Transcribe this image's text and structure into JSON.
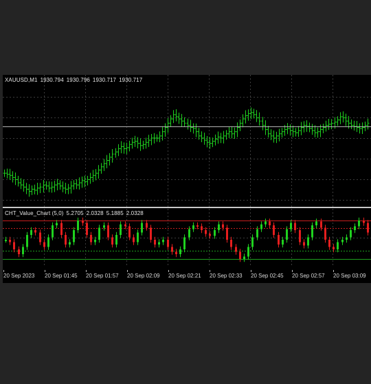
{
  "main": {
    "symbol": "XAUUSD,M1",
    "open": "1930.794",
    "high": "1930.796",
    "low": "1930.717",
    "close": "1930.717"
  },
  "indicator": {
    "name": "CHT_Value_Chart (5,0)",
    "v1": "5.2705",
    "v2": "2.0328",
    "v3": "5.1885",
    "v4": "2.0328"
  },
  "time_axis": [
    "20 Sep 2023",
    "20 Sep 01:45",
    "20 Sep 01:57",
    "20 Sep 02:09",
    "20 Sep 02:21",
    "20 Sep 02:33",
    "20 Sep 02:45",
    "20 Sep 02:57",
    "20 Sep 03:09"
  ],
  "colors": {
    "background": "#000000",
    "grid": "#3c3c3c",
    "bar_up": "#1fd21f",
    "bar_down": "#e61e1e",
    "level_red": "#c81e1e",
    "level_green": "#1ea01e",
    "price_line": "#b4b4b4"
  },
  "chart_data": [
    {
      "type": "ohlc",
      "series": "XAUUSD,M1",
      "closes": [
        0.27,
        0.26,
        0.25,
        0.23,
        0.21,
        0.18,
        0.16,
        0.14,
        0.12,
        0.1,
        0.12,
        0.11,
        0.13,
        0.14,
        0.16,
        0.15,
        0.13,
        0.14,
        0.16,
        0.17,
        0.15,
        0.13,
        0.12,
        0.13,
        0.15,
        0.17,
        0.16,
        0.18,
        0.2,
        0.19,
        0.21,
        0.23,
        0.25,
        0.27,
        0.3,
        0.33,
        0.36,
        0.39,
        0.42,
        0.45,
        0.47,
        0.5,
        0.52,
        0.5,
        0.51,
        0.54,
        0.56,
        0.57,
        0.55,
        0.53,
        0.54,
        0.56,
        0.58,
        0.6,
        0.6,
        0.6,
        0.62,
        0.66,
        0.7,
        0.74,
        0.78,
        0.82,
        0.8,
        0.78,
        0.76,
        0.74,
        0.72,
        0.7,
        0.69,
        0.66,
        0.62,
        0.6,
        0.58,
        0.56,
        0.55,
        0.57,
        0.59,
        0.61,
        0.6,
        0.62,
        0.64,
        0.66,
        0.64,
        0.66,
        0.7,
        0.74,
        0.78,
        0.81,
        0.83,
        0.84,
        0.82,
        0.79,
        0.76,
        0.72,
        0.68,
        0.64,
        0.62,
        0.6,
        0.62,
        0.64,
        0.66,
        0.68,
        0.69,
        0.67,
        0.66,
        0.65,
        0.67,
        0.7,
        0.72,
        0.71,
        0.69,
        0.67,
        0.65,
        0.66,
        0.68,
        0.7,
        0.72,
        0.73,
        0.74,
        0.75,
        0.77,
        0.8,
        0.79,
        0.76,
        0.74,
        0.72,
        0.71,
        0.7,
        0.69,
        0.7,
        0.72,
        0.74
      ],
      "current_price_level": 0.71
    },
    {
      "type": "ohlc",
      "series": "CHT_Value_Chart (5,0)",
      "closes": [
        0.5,
        0.45,
        0.3,
        0.2,
        0.35,
        0.6,
        0.7,
        0.65,
        0.45,
        0.35,
        0.55,
        0.8,
        0.85,
        0.6,
        0.4,
        0.45,
        0.7,
        0.9,
        0.85,
        0.6,
        0.45,
        0.5,
        0.75,
        0.8,
        0.55,
        0.4,
        0.6,
        0.82,
        0.78,
        0.55,
        0.45,
        0.65,
        0.85,
        0.75,
        0.5,
        0.4,
        0.45,
        0.5,
        0.35,
        0.25,
        0.2,
        0.3,
        0.55,
        0.72,
        0.8,
        0.78,
        0.7,
        0.62,
        0.58,
        0.7,
        0.82,
        0.75,
        0.5,
        0.35,
        0.25,
        0.1,
        0.15,
        0.35,
        0.55,
        0.72,
        0.82,
        0.88,
        0.8,
        0.6,
        0.4,
        0.5,
        0.72,
        0.85,
        0.7,
        0.45,
        0.38,
        0.55,
        0.8,
        0.88,
        0.75,
        0.5,
        0.35,
        0.3,
        0.45,
        0.5,
        0.55,
        0.7,
        0.78,
        0.9,
        0.85,
        0.65
      ]
    }
  ]
}
